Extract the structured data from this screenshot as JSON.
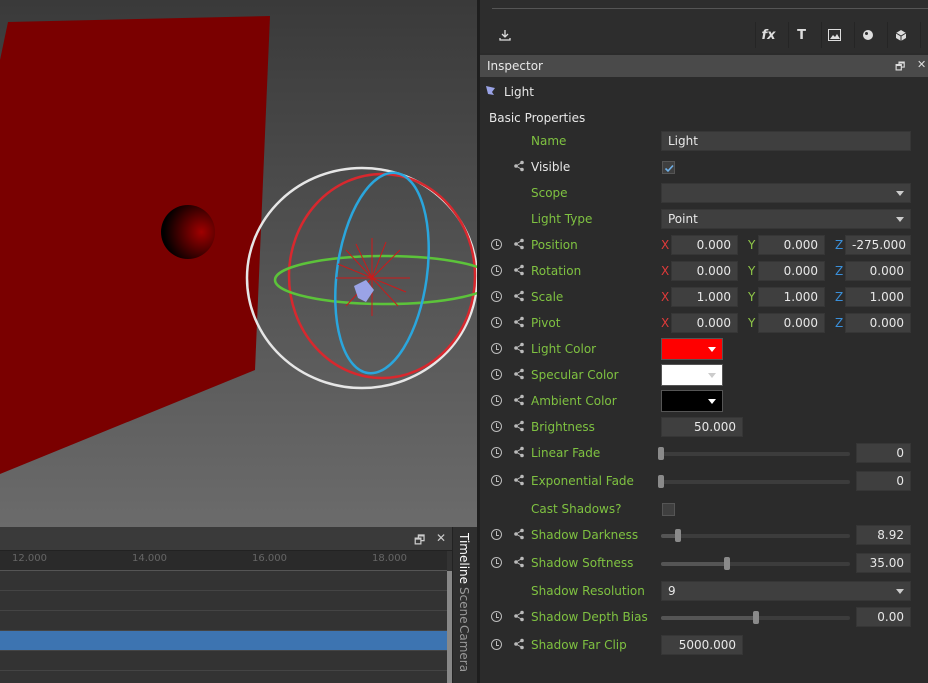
{
  "timeline": {
    "ruler_ticks": [
      "12.000",
      "14.000",
      "16.000",
      "18.000"
    ],
    "tabs": [
      "Timeline",
      "Scene",
      "Camera"
    ]
  },
  "toolbar": {
    "icons": [
      "import-icon",
      "effects-icon",
      "text-icon",
      "image-icon",
      "sphere-icon",
      "cube-icon"
    ],
    "fx_label": "fx",
    "text_label": "T"
  },
  "inspector": {
    "title": "Inspector",
    "object_name": "Light",
    "section": "Basic Properties",
    "props": {
      "name": {
        "label": "Name",
        "value": "Light"
      },
      "visible": {
        "label": "Visible",
        "checked": true
      },
      "scope": {
        "label": "Scope",
        "value": ""
      },
      "light_type": {
        "label": "Light Type",
        "value": "Point"
      },
      "position": {
        "label": "Position",
        "x": "0.000",
        "y": "0.000",
        "z": "-275.000"
      },
      "rotation": {
        "label": "Rotation",
        "x": "0.000",
        "y": "0.000",
        "z": "0.000"
      },
      "scale": {
        "label": "Scale",
        "x": "1.000",
        "y": "1.000",
        "z": "1.000"
      },
      "pivot": {
        "label": "Pivot",
        "x": "0.000",
        "y": "0.000",
        "z": "0.000"
      },
      "light_color": {
        "label": "Light Color",
        "color": "#ff0000"
      },
      "specular_color": {
        "label": "Specular Color",
        "color": "#ffffff"
      },
      "ambient_color": {
        "label": "Ambient Color",
        "color": "#000000"
      },
      "brightness": {
        "label": "Brightness",
        "value": "50.000"
      },
      "linear_fade": {
        "label": "Linear Fade",
        "value": "0",
        "level": 0
      },
      "exponential_fade": {
        "label": "Exponential Fade",
        "value": "0",
        "level": 0
      },
      "cast_shadows": {
        "label": "Cast Shadows?",
        "checked": false
      },
      "shadow_darkness": {
        "label": "Shadow Darkness",
        "value": "8.92",
        "level": 0.09
      },
      "shadow_softness": {
        "label": "Shadow Softness",
        "value": "35.00",
        "level": 0.35
      },
      "shadow_resolution": {
        "label": "Shadow Resolution",
        "value": "9"
      },
      "shadow_depth_bias": {
        "label": "Shadow Depth Bias",
        "value": "0.00",
        "level": 0.5
      },
      "shadow_far_clip": {
        "label": "Shadow Far Clip",
        "value": "5000.000"
      }
    },
    "axis_labels": {
      "x": "X",
      "y": "Y",
      "z": "Z"
    }
  },
  "colors": {
    "accent_green": "#7fc241",
    "selection_blue": "#3d74b1"
  }
}
